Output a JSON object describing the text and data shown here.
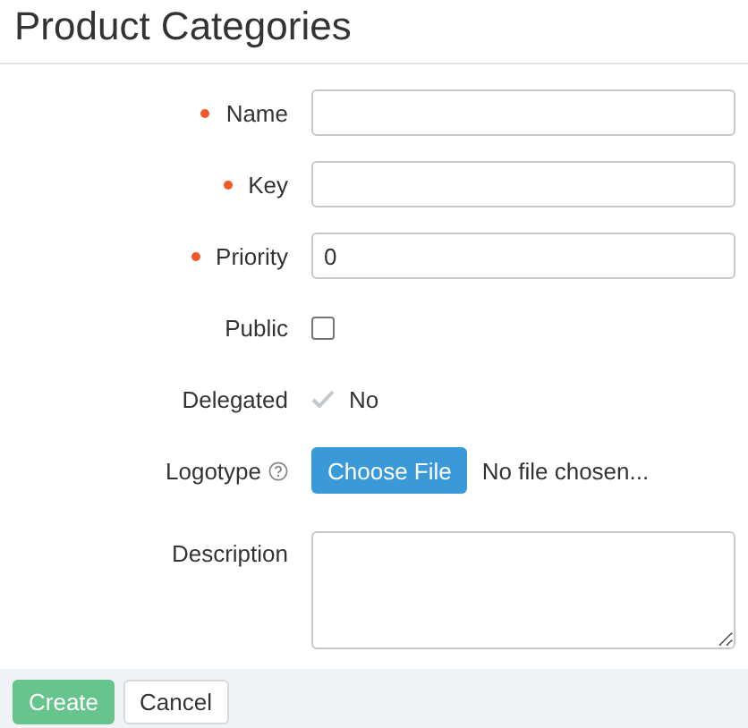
{
  "title": "Product Categories",
  "fields": [
    {
      "kind": "text",
      "label": "Name",
      "required": true,
      "help": false
    },
    {
      "kind": "text",
      "label": "Key",
      "required": true,
      "help": false
    },
    {
      "kind": "text",
      "label": "Priority",
      "required": true,
      "help": false,
      "value": "0"
    },
    {
      "kind": "checkbox",
      "label": "Public",
      "required": false,
      "help": false,
      "checked": false
    },
    {
      "kind": "readonly",
      "label": "Delegated",
      "required": false,
      "help": false,
      "value": "No"
    },
    {
      "kind": "file",
      "label": "Logotype",
      "required": false,
      "help": true,
      "button": "Choose File",
      "status": "No file chosen..."
    },
    {
      "kind": "textarea",
      "label": "Description",
      "required": false,
      "help": false
    }
  ],
  "buttons": [
    {
      "label": "Create",
      "kind": "primary"
    },
    {
      "label": "Cancel",
      "kind": "secondary"
    }
  ]
}
